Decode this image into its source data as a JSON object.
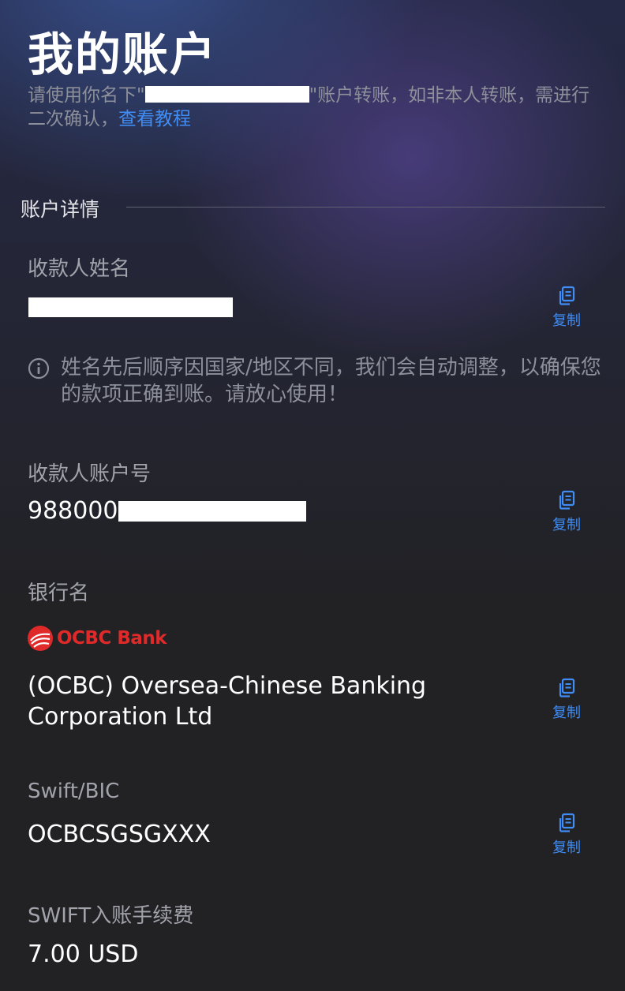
{
  "page": {
    "title": "我的账户",
    "notice": {
      "prefix": "请使用你名下\"",
      "suffix": "\"账户转账，如非本人转账，需进行二次确认，",
      "link": "查看教程"
    }
  },
  "account_details": {
    "section_title": "账户详情",
    "copy_label": "复制",
    "payee_name": {
      "label": "收款人姓名"
    },
    "name_note": "姓名先后顺序因国家/地区不同，我们会自动调整，以确保您的款项正确到账。请放心使用！",
    "account_number": {
      "label": "收款人账户号",
      "value_visible": "988000"
    },
    "bank": {
      "label": "银行名",
      "logo_text": "OCBC Bank",
      "name_line1": "(OCBC) Oversea-Chinese Banking",
      "name_line2": "Corporation Ltd"
    },
    "swift": {
      "label": "Swift/BIC",
      "value": "OCBCSGSGXXX"
    },
    "fee": {
      "label": "SWIFT入账手续费",
      "value": "7.00 USD"
    }
  },
  "colors": {
    "accent": "#3f8df5",
    "brand_red": "#e02a2a",
    "background": "#222225"
  }
}
